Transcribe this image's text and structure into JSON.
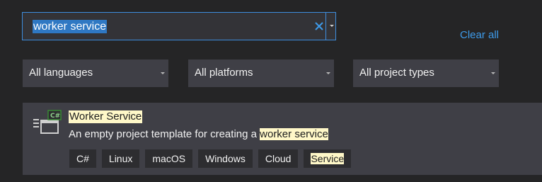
{
  "search": {
    "value": "worker service"
  },
  "clear_all_label": "Clear all",
  "filters": {
    "languages": "All languages",
    "platforms": "All platforms",
    "project_types": "All project types"
  },
  "template": {
    "title": "Worker Service",
    "description_prefix": "An empty project template for creating a ",
    "description_highlight": "worker service",
    "icon_badge": "C#",
    "tags": [
      "C#",
      "Linux",
      "macOS",
      "Windows",
      "Cloud",
      "Service"
    ]
  },
  "colors": {
    "accent": "#3e8ede",
    "link": "#3e9bea",
    "highlight": "#fff8c8",
    "background": "#252526",
    "panel": "#3f3f46"
  }
}
